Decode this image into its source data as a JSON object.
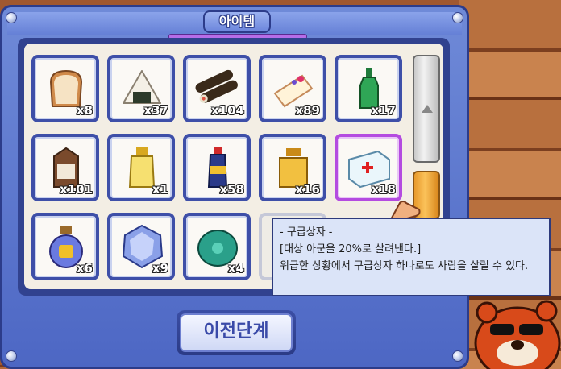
{
  "window": {
    "title": "아이템"
  },
  "inventory": {
    "items": [
      {
        "name": "bread-icon",
        "qty": "x8"
      },
      {
        "name": "rice-ball-icon",
        "qty": "x37"
      },
      {
        "name": "gimbap-icon",
        "qty": "x104"
      },
      {
        "name": "cake-icon",
        "qty": "x89"
      },
      {
        "name": "green-bottle-icon",
        "qty": "x17"
      },
      {
        "name": "milk-carton-icon",
        "qty": "x101"
      },
      {
        "name": "yellow-bottle-icon",
        "qty": "x1"
      },
      {
        "name": "tonic-bottle-icon",
        "qty": "x58"
      },
      {
        "name": "honey-jar-icon",
        "qty": "x16"
      },
      {
        "name": "first-aid-kit-icon",
        "qty": "x18"
      },
      {
        "name": "potion-flask-icon",
        "qty": "x6"
      },
      {
        "name": "crystal-stone-icon",
        "qty": "x9"
      },
      {
        "name": "turtle-shell-icon",
        "qty": "x4"
      }
    ],
    "selected_index": 9
  },
  "tooltip": {
    "title": "- 구급상자 -",
    "effect": "[대상 아군을 20%로 살려낸다.]",
    "description": "위급한 상황에서 구급상자 하나로도 사람을 살릴 수 있다."
  },
  "buttons": {
    "prev_step": "이전단계"
  },
  "colors": {
    "frame": "#4d67c4",
    "selected": "#b44be0",
    "thumb": "#fbc25a"
  }
}
